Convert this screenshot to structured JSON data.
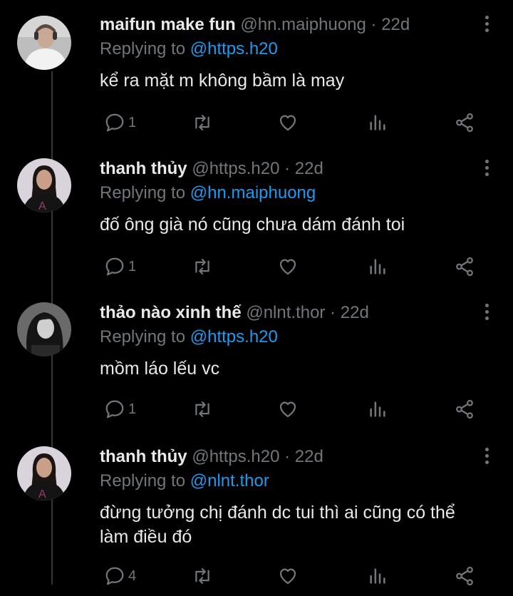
{
  "colors": {
    "background": "#000000",
    "text": "#e7e9ea",
    "muted": "#71767b",
    "link": "#1d9bf0",
    "thread_line": "#333639"
  },
  "tweets": [
    {
      "display_name": "maifun make fun",
      "handle": "@hn.maiphuong",
      "separator": " · ",
      "time": "22d",
      "replying_prefix": "Replying to ",
      "replying_to": "@https.h20",
      "text": "kể ra mặt m không bầm là may",
      "reply_count": "1",
      "avatar": "person-white-hoodie-headphones"
    },
    {
      "display_name": "thanh thủy",
      "handle": "@https.h20",
      "separator": " · ",
      "time": "22d",
      "replying_prefix": "Replying to ",
      "replying_to": "@hn.maiphuong",
      "text": "đố ông già nó cũng chưa dám đánh toi",
      "reply_count": "1",
      "avatar": "person-black-tshirt"
    },
    {
      "display_name": "thảo nào xinh thế",
      "handle": "@nlnt.thor",
      "separator": " · ",
      "time": "22d",
      "replying_prefix": "Replying to ",
      "replying_to": "@https.h20",
      "text": "mồm láo lếu vc",
      "reply_count": "1",
      "avatar": "person-monochrome"
    },
    {
      "display_name": "thanh thủy",
      "handle": "@https.h20",
      "separator": " · ",
      "time": "22d",
      "replying_prefix": "Replying to ",
      "replying_to": "@nlnt.thor",
      "text": "đừng tưởng chị đánh dc tui thì ai cũng có thể làm điều đó",
      "reply_count": "4",
      "avatar": "person-black-tshirt"
    }
  ],
  "action_icons": [
    "reply-icon",
    "retweet-icon",
    "like-icon",
    "analytics-icon",
    "share-icon"
  ]
}
